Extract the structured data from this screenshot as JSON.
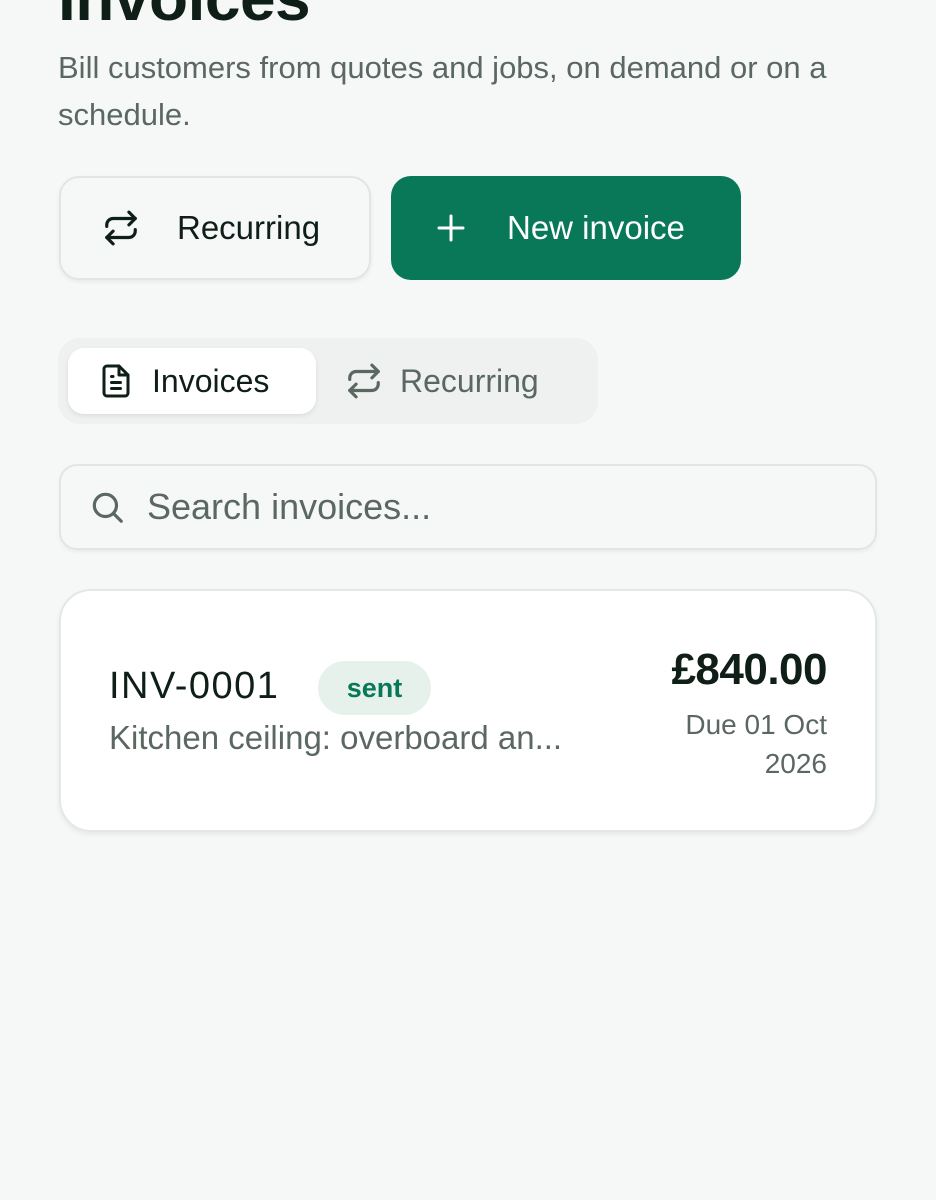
{
  "header": {
    "title": "Invoices",
    "subtitle": "Bill customers from quotes and jobs, on demand or on a schedule."
  },
  "actions": {
    "recurring_label": "Recurring",
    "new_invoice_label": "New invoice"
  },
  "tabs": [
    {
      "label": "Invoices",
      "icon": "document-icon",
      "active": true
    },
    {
      "label": "Recurring",
      "icon": "repeat-icon",
      "active": false
    }
  ],
  "search": {
    "placeholder": "Search invoices..."
  },
  "invoices": [
    {
      "number": "INV-0001",
      "status": "sent",
      "description": "Kitchen ceiling: overboard an...",
      "amount": "£840.00",
      "due": "Due 01 Oct 2026"
    }
  ],
  "colors": {
    "accent": "#087858",
    "text": "#0f1f17",
    "muted": "#5b6862",
    "background": "#f6f8f7",
    "badge_bg": "#e6f1ec"
  }
}
